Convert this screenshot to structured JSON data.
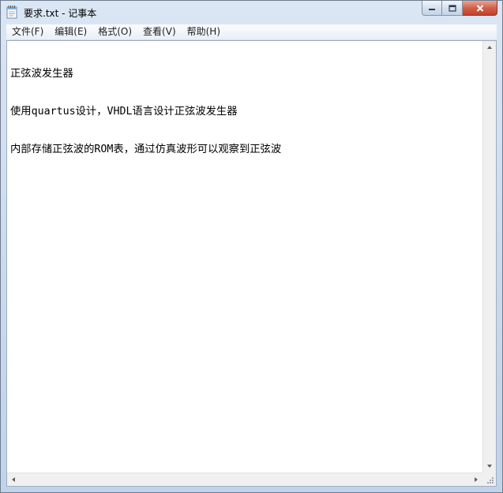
{
  "window": {
    "title": "要求.txt - 记事本",
    "icon": "notepad-icon"
  },
  "caption": {
    "minimize_icon": "minimize-icon",
    "maximize_icon": "maximize-icon",
    "close_icon": "close-icon"
  },
  "menu": {
    "items": [
      {
        "label": "文件(F)"
      },
      {
        "label": "编辑(E)"
      },
      {
        "label": "格式(O)"
      },
      {
        "label": "查看(V)"
      },
      {
        "label": "帮助(H)"
      }
    ]
  },
  "document": {
    "lines": [
      "正弦波发生器",
      "使用quartus设计，VHDL语言设计正弦波发生器",
      "内部存储正弦波的ROM表，通过仿真波形可以观察到正弦波"
    ]
  },
  "colors": {
    "close_button": "#c2402a",
    "frame": "#c9d9ee",
    "text": "#000000"
  }
}
